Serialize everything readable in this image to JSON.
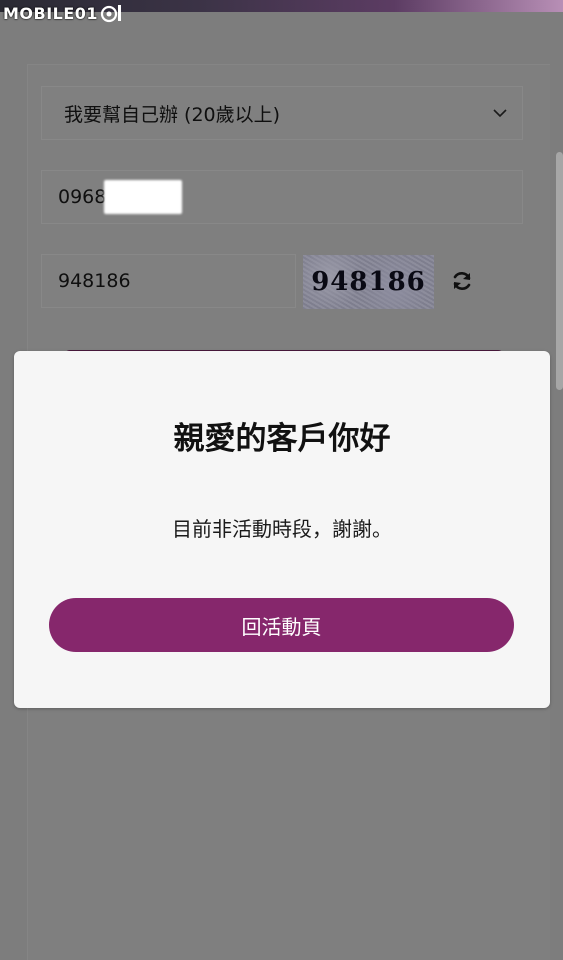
{
  "watermark": {
    "text": "MOBILE01",
    "logo_icon": "mobile01-logo-icon"
  },
  "form": {
    "applicant_select": {
      "selected": "我要幫自己辦 (20歲以上)",
      "icon": "chevron-down-icon"
    },
    "phone": {
      "value": "0968"
    },
    "captcha_input": {
      "value": "948186"
    },
    "captcha_image": {
      "text": "948186"
    },
    "refresh_icon": "refresh-icon"
  },
  "modal": {
    "title": "親愛的客戶你好",
    "message": "目前非活動時段，謝謝。",
    "button_label": "回活動頁"
  },
  "colors": {
    "accent": "#86276c",
    "overlay": "#7d7d7d",
    "modal_bg": "#f6f6f6"
  }
}
